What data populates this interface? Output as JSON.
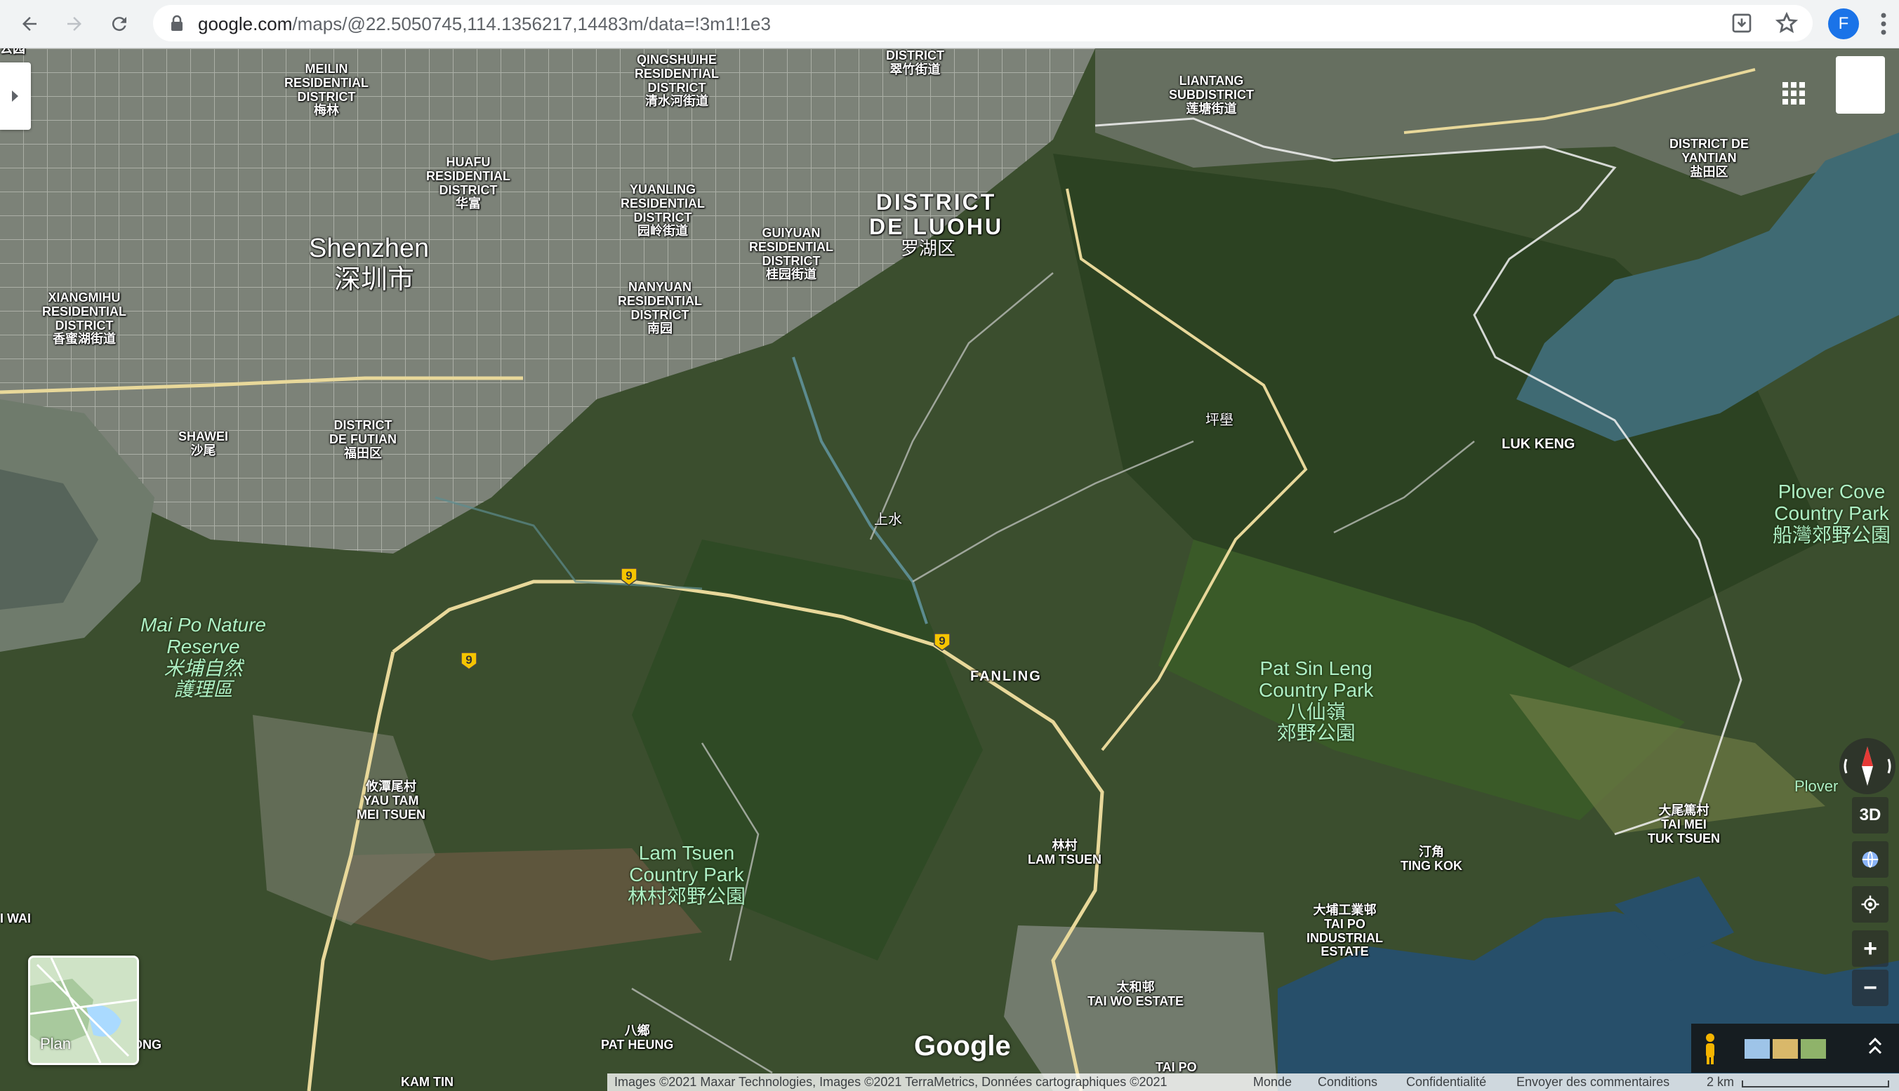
{
  "browser": {
    "url_host": "google.com",
    "url_path": "/maps/@22.5050745,114.1356217,14483m/data=!3m1!1e3",
    "profile_initial": "F",
    "icons": [
      "back-arrow-icon",
      "forward-arrow-icon",
      "reload-icon",
      "lock-icon",
      "install-icon",
      "star-icon",
      "kebab-menu-icon"
    ]
  },
  "map": {
    "labels": {
      "top_left_fragment": "云园",
      "meilin": "MEILIN\nRESIDENTIAL\nDISTRICT\n梅林",
      "qingshuihe": "QINGSHUIHE\nRESIDENTIAL\nDISTRICT\n清水河街道",
      "district_cuizhu": "DISTRICT\n翠竹街道",
      "liantang": "LIANTANG\nSUBDISTRICT\n莲塘街道",
      "yantian": "DISTRICT DE\nYANTIAN\n盐田区",
      "huafu": "HUAFU\nRESIDENTIAL\nDISTRICT\n华富",
      "yuanling": "YUANLING\nRESIDENTIAL\nDISTRICT\n园岭街道",
      "guiyuan": "GUIYUAN\nRESIDENTIAL\nDISTRICT\n桂园街道",
      "luohu": "DISTRICT\nDE LUOHU",
      "luohu_cn": "罗湖区",
      "shenzhen": "Shenzhen",
      "shenzhen_cn": "深圳市",
      "xiangmihu": "XIANGMIHU\nRESIDENTIAL\nDISTRICT\n香蜜湖街道",
      "nanyuan": "NANYUAN\nRESIDENTIAL\nDISTRICT\n南园",
      "pingzhang": "坪壆",
      "luk_keng": "LUK KENG",
      "shawei": "SHAWEI\n沙尾",
      "futian": "DISTRICT\nDE FUTIAN\n福田区",
      "plover_cove": "Plover Cove\nCountry Park\n船灣郊野公園",
      "sheung_shui": "上水",
      "mai_po": "Mai Po Nature\nReserve\n米埔自然\n護理區",
      "fanling": "FANLING",
      "pat_sin_leng": "Pat Sin Leng\nCountry Park\n八仙嶺\n郊野公園",
      "plover_fragment": "Plover",
      "yau_tam_mei": "攸潭尾村\nYAU TAM\nMEI TSUEN",
      "lam_tsuen_cp": "Lam Tsuen\nCountry Park\n林村郊野公園",
      "tai_mei_tuk": "大尾篤村\nTAI MEI\nTUK TSUEN",
      "lam_tsuen": "林村\nLAM TSUEN",
      "ting_kok": "汀角\nTING KOK",
      "wai_fragment": "I WAI",
      "tai_po_industrial": "大埔工業邨\nTAI PO\nINDUSTRIAL\nESTATE",
      "tai_wo": "太和邨\nTAI WO ESTATE",
      "ong_fragment": "ONG",
      "pat_heung": "八鄉\nPAT HEUNG",
      "kam_tin": "KAM TIN",
      "tai_po": "TAI PO"
    },
    "route_shield": "9",
    "google_logo": "Google",
    "plan_label": "Plan",
    "controls": {
      "three_d": "3D",
      "zoom_in": "+",
      "zoom_out": "−"
    },
    "colors": {
      "water": "#3f6a73",
      "vegetation": "#33502a",
      "urban": "#8c9488",
      "road": "#e8d89a",
      "shield": "#f5c400"
    }
  },
  "footer": {
    "attribution": "Images ©2021 Maxar Technologies, Images ©2021 TerraMetrics, Données cartographiques ©2021",
    "monde": "Monde",
    "conditions": "Conditions",
    "confidentialite": "Confidentialité",
    "feedback": "Envoyer des commentaires",
    "scale": "2 km"
  }
}
